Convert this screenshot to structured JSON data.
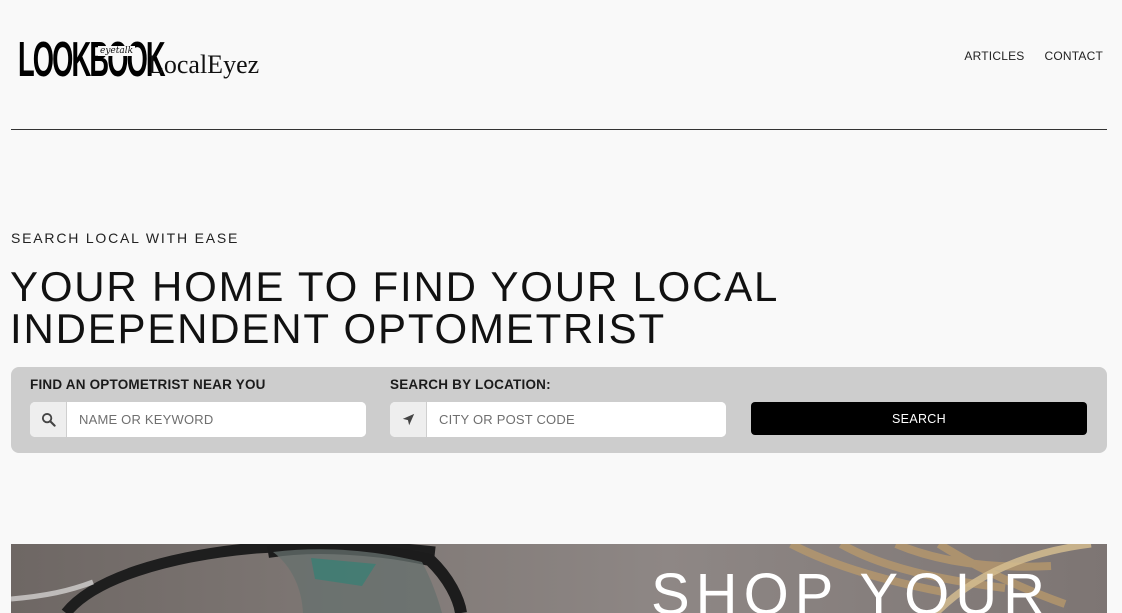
{
  "brand": {
    "wordmark": "LOOKBOOK",
    "script": "eyetalk",
    "name": "LocalEyez"
  },
  "nav": {
    "items": [
      {
        "label": "ARTICLES"
      },
      {
        "label": "CONTACT"
      }
    ]
  },
  "hero": {
    "eyebrow": "SEARCH LOCAL WITH EASE",
    "title": "YOUR HOME TO FIND YOUR LOCAL INDEPENDENT OPTOMETRIST"
  },
  "search": {
    "name_label": "FIND AN OPTOMETRIST NEAR YOU",
    "name_placeholder": "NAME OR KEYWORD",
    "name_icon": "search-icon",
    "location_label": "SEARCH BY LOCATION:",
    "location_placeholder": "CITY OR POST CODE",
    "location_icon": "location-arrow-icon",
    "button_label": "SEARCH"
  },
  "banner": {
    "text": "SHOP YOUR"
  },
  "colors": {
    "background": "#f9f9f9",
    "panel": "#cdcdcd",
    "button": "#000000",
    "text": "#111111"
  }
}
